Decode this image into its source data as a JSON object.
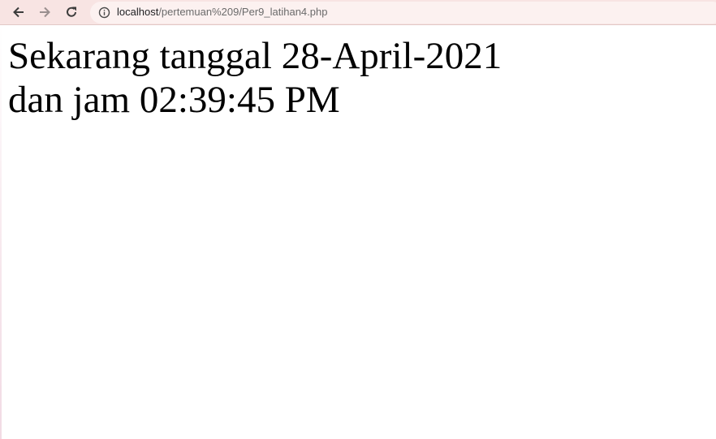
{
  "browser": {
    "address_bar": {
      "host": "localhost",
      "path": "/pertemuan%209/Per9_latihan4.php"
    },
    "icons": {
      "back": "arrow-left-icon",
      "forward": "arrow-right-icon",
      "reload": "reload-icon",
      "site_info": "info-circle-icon"
    },
    "colors": {
      "toolbar_bg": "#f8e4e3",
      "omnibox_bg": "#fcf1f0"
    }
  },
  "page": {
    "line1": "Sekarang tanggal 28-April-2021",
    "line2": "dan jam 02:39:45 PM"
  }
}
